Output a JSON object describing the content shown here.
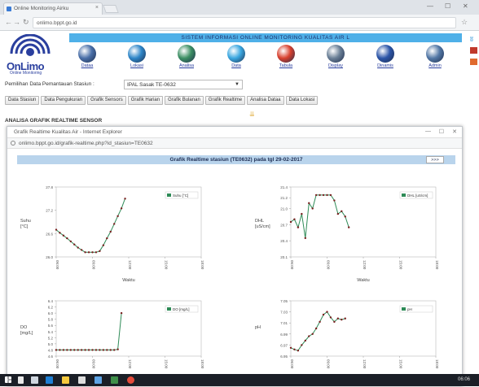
{
  "browser": {
    "tab_title": "Online Monitoring Airku",
    "tab_close": "×",
    "url": "onlimo.bppt.go.id",
    "minimize": "—",
    "maximize": "☐",
    "close": "✕"
  },
  "header": {
    "banner": "SISTEM INFORMASI ONLINE MONITORING KUALITAS AIR L",
    "logo_text": "OnLimo",
    "logo_sub": "Online Monitoring"
  },
  "menu": [
    {
      "label": "Dataa",
      "color": "#4a6fa8"
    },
    {
      "label": "Lokasi",
      "color": "#2e86c8"
    },
    {
      "label": "Analisa",
      "color": "#3c8f63"
    },
    {
      "label": "Data",
      "color": "#3aa7e0"
    },
    {
      "label": "Tabula",
      "color": "#d8402e"
    },
    {
      "label": "Display",
      "color": "#6a7f96"
    },
    {
      "label": "Dinamis",
      "color": "#2c55a8"
    },
    {
      "label": "Admin",
      "color": "#5378a6"
    }
  ],
  "station": {
    "label": "Pemilihan Data Pemantauan Stasiun :",
    "selected": "IPAL Sasak TE-0632"
  },
  "buttons": [
    "Data Stasiun",
    "Data Pengukuran",
    "Grafik Sensors",
    "Grafik Harian",
    "Grafik Bulanan",
    "Grafik Realtime",
    "Analisa Dataa",
    "Data Lokasi"
  ],
  "section_title": "ANALISA GRAFIK REALTIME SENSOR",
  "modal": {
    "title": "Grafik Realtime Kualitas Air - Internet Explorer",
    "url": "onlimo.bppt.go.id/grafik-realtime.php?id_stasiun=TE0632",
    "heading": "Grafik Realtime stasiun (TE0632) pada tgl 29-02-2017",
    "more_button": ">>>"
  },
  "chart_data": [
    {
      "type": "line",
      "ylabel": "Suhu\n[°C]",
      "xlabel": "Waktu",
      "legend": "Suhu [°C]",
      "ylim": [
        26,
        27.8
      ],
      "y_ticks": [
        26.0,
        26.6,
        27.2,
        27.8
      ],
      "x_ticks": [
        "06:00",
        "09:00",
        "12:00",
        "15:00",
        "18:00"
      ],
      "x_range": [
        6,
        18
      ],
      "color": "#2e8b57",
      "x": [
        6.0,
        6.3,
        6.6,
        6.9,
        7.2,
        7.5,
        7.8,
        8.1,
        8.4,
        8.7,
        9.0,
        9.3,
        9.6,
        9.9,
        10.2,
        10.5,
        10.8,
        11.1,
        11.4,
        11.7
      ],
      "y": [
        26.7,
        26.62,
        26.55,
        26.48,
        26.4,
        26.32,
        26.24,
        26.18,
        26.12,
        26.12,
        26.12,
        26.12,
        26.15,
        26.3,
        26.48,
        26.65,
        26.85,
        27.05,
        27.25,
        27.5
      ]
    },
    {
      "type": "line",
      "ylabel": "DHL\n[uS/cm]",
      "xlabel": "Waktu",
      "legend": "DHL [uS/cm]",
      "ylim": [
        20.1,
        21.4
      ],
      "y_ticks": [
        20.1,
        20.4,
        20.7,
        21.0,
        21.2,
        21.4
      ],
      "x_ticks": [
        "06:00",
        "09:00",
        "12:00",
        "15:00",
        "18:00"
      ],
      "x_range": [
        6,
        18
      ],
      "color": "#2e8b57",
      "x": [
        6.0,
        6.3,
        6.6,
        6.9,
        7.2,
        7.5,
        7.8,
        8.1,
        8.4,
        8.7,
        9.0,
        9.3,
        9.6,
        9.9,
        10.2,
        10.5,
        10.8
      ],
      "y": [
        20.75,
        20.8,
        20.65,
        20.9,
        20.45,
        21.1,
        21.0,
        21.25,
        21.25,
        21.25,
        21.25,
        21.25,
        21.15,
        20.9,
        20.95,
        20.85,
        20.65
      ]
    },
    {
      "type": "line",
      "ylabel": "DO\n[mg/L]",
      "xlabel": "",
      "legend": "DO [mg/L]",
      "ylim": [
        4.6,
        6.4
      ],
      "y_ticks": [
        4.6,
        4.8,
        5.0,
        5.2,
        5.4,
        5.6,
        5.8,
        6.0,
        6.2,
        6.4
      ],
      "x_ticks": [
        "06:00",
        "09:00",
        "12:00",
        "15:00",
        "18:00"
      ],
      "x_range": [
        6,
        18
      ],
      "color": "#2e8b57",
      "x": [
        6.0,
        6.3,
        6.6,
        6.9,
        7.2,
        7.5,
        7.8,
        8.1,
        8.4,
        8.7,
        9.0,
        9.3,
        9.6,
        9.9,
        10.2,
        10.5,
        10.8,
        11.1,
        11.4
      ],
      "y": [
        4.8,
        4.8,
        4.8,
        4.8,
        4.8,
        4.8,
        4.8,
        4.8,
        4.8,
        4.8,
        4.8,
        4.8,
        4.8,
        4.8,
        4.8,
        4.8,
        4.8,
        4.82,
        6.0
      ]
    },
    {
      "type": "line",
      "ylabel": "pH",
      "xlabel": "",
      "legend": "pH",
      "ylim": [
        6.95,
        7.05
      ],
      "y_ticks": [
        6.95,
        6.97,
        6.99,
        7.01,
        7.03,
        7.05
      ],
      "x_ticks": [
        "06:00",
        "09:00",
        "12:00",
        "15:00",
        "18:00"
      ],
      "x_range": [
        6,
        18
      ],
      "color": "#2e8b57",
      "x": [
        6.0,
        6.3,
        6.6,
        6.9,
        7.2,
        7.5,
        7.8,
        8.1,
        8.4,
        8.7,
        9.0,
        9.3,
        9.6,
        9.9,
        10.2,
        10.5
      ],
      "y": [
        6.965,
        6.962,
        6.96,
        6.97,
        6.978,
        6.986,
        6.99,
        7.0,
        7.012,
        7.025,
        7.03,
        7.02,
        7.012,
        7.018,
        7.016,
        7.018
      ]
    }
  ],
  "taskbar": {
    "time": "06:06"
  }
}
